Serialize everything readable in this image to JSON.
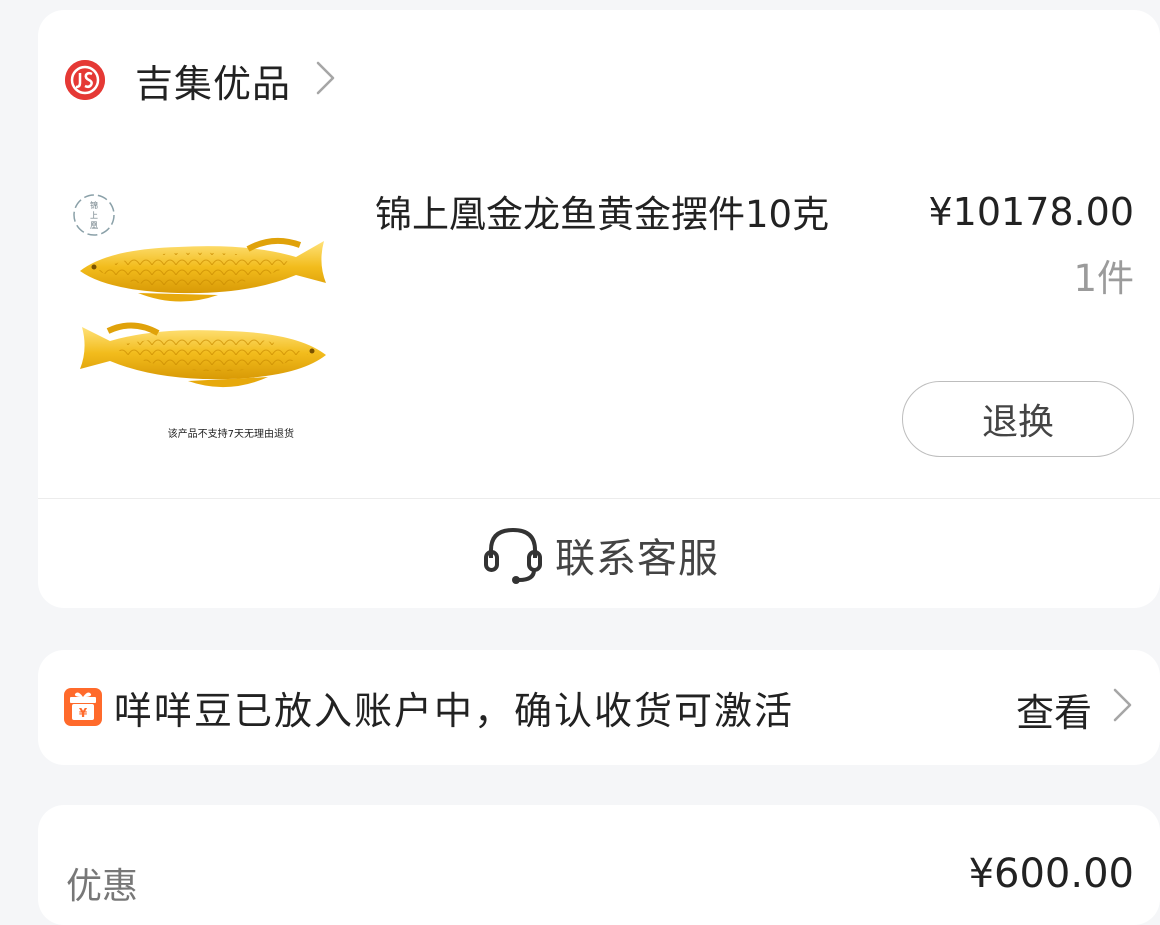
{
  "shop": {
    "name": "吉集优品",
    "logo_text": "JS",
    "logo_color": "#e53935"
  },
  "product": {
    "title": "锦上凰金龙鱼黄金摆件10克",
    "price": "¥10178.00",
    "quantity": "1件",
    "image_badge_text": "锦上凰",
    "image_caption": "该产品不支持7天无理由退货",
    "return_button": "退换"
  },
  "contact": {
    "label": "联系客服",
    "icon": "headset-icon"
  },
  "beans": {
    "message": "咩咩豆已放入账户中，确认收货可激活",
    "link_label": "查看",
    "icon": "gift-icon",
    "icon_color": "#ff6a2b"
  },
  "discount": {
    "label": "优惠",
    "value": "¥600.00"
  },
  "colors": {
    "background": "#f5f6f8",
    "card": "#ffffff",
    "gold": "#f2bc1c"
  }
}
